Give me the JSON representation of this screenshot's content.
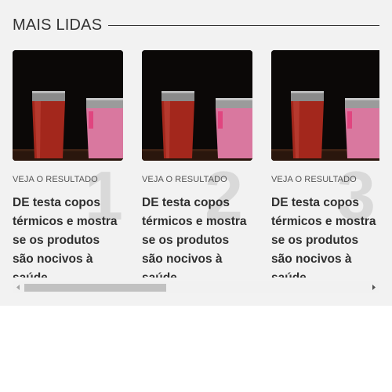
{
  "section": {
    "title": "MAIS LIDAS"
  },
  "cards": [
    {
      "rank": "1",
      "kicker": "VEJA O RESULTADO",
      "title": "DE testa copos térmicos e mostra se os produtos são nocivos à saúde",
      "image_icon": "thermal-cups-photo"
    },
    {
      "rank": "2",
      "kicker": "VEJA O RESULTADO",
      "title": "DE testa copos térmicos e mostra se os produtos são nocivos à saúde",
      "image_icon": "thermal-cups-photo"
    },
    {
      "rank": "3",
      "kicker": "VEJA O RESULTADO",
      "title": "DE testa copos térmicos e mostra se os produtos são nocivos à saúde",
      "image_icon": "thermal-cups-photo"
    }
  ],
  "scrollbar": {
    "position_fraction": 0.0,
    "visible_fraction": 0.42
  },
  "colors": {
    "background": "#f2f2f2",
    "rank_numeral": "#d9d9d9",
    "headline": "#2f2f2f",
    "cup_red": "#a3271c",
    "cup_pink": "#d9789f"
  }
}
